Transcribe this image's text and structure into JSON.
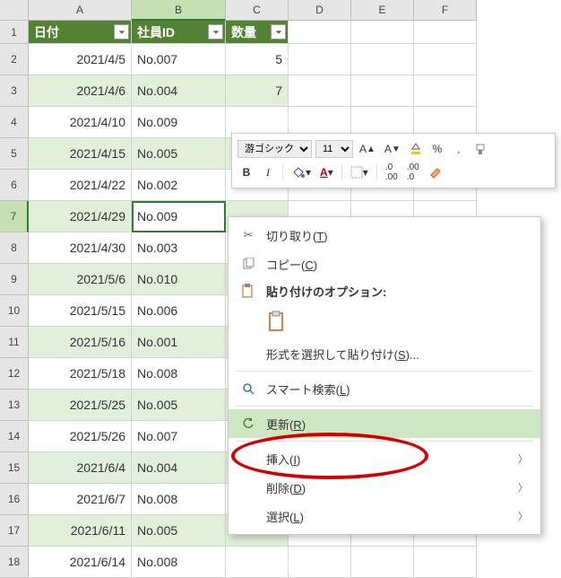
{
  "columns": [
    "A",
    "B",
    "C",
    "D",
    "E",
    "F"
  ],
  "headers": {
    "date": "日付",
    "empId": "社員ID",
    "qty": "数量"
  },
  "rows": [
    {
      "n": 1
    },
    {
      "n": 2,
      "date": "2021/4/5",
      "emp": "No.007",
      "qty": 5
    },
    {
      "n": 3,
      "date": "2021/4/6",
      "emp": "No.004",
      "qty": 7
    },
    {
      "n": 4,
      "date": "2021/4/10",
      "emp": "No.009",
      "qty": ""
    },
    {
      "n": 5,
      "date": "2021/4/15",
      "emp": "No.005",
      "qty": ""
    },
    {
      "n": 6,
      "date": "2021/4/22",
      "emp": "No.002",
      "qty": ""
    },
    {
      "n": 7,
      "date": "2021/4/29",
      "emp": "No.009",
      "qty": ""
    },
    {
      "n": 8,
      "date": "2021/4/30",
      "emp": "No.003",
      "qty": ""
    },
    {
      "n": 9,
      "date": "2021/5/6",
      "emp": "No.010",
      "qty": ""
    },
    {
      "n": 10,
      "date": "2021/5/15",
      "emp": "No.006",
      "qty": ""
    },
    {
      "n": 11,
      "date": "2021/5/16",
      "emp": "No.001",
      "qty": ""
    },
    {
      "n": 12,
      "date": "2021/5/18",
      "emp": "No.008",
      "qty": ""
    },
    {
      "n": 13,
      "date": "2021/5/25",
      "emp": "No.005",
      "qty": ""
    },
    {
      "n": 14,
      "date": "2021/5/26",
      "emp": "No.007",
      "qty": ""
    },
    {
      "n": 15,
      "date": "2021/6/4",
      "emp": "No.004",
      "qty": ""
    },
    {
      "n": 16,
      "date": "2021/6/7",
      "emp": "No.008",
      "qty": ""
    },
    {
      "n": 17,
      "date": "2021/6/11",
      "emp": "No.005",
      "qty": ""
    },
    {
      "n": 18,
      "date": "2021/6/14",
      "emp": "No.008",
      "qty": ""
    }
  ],
  "activeRow": 7,
  "toolbar": {
    "font": "游ゴシック",
    "size": "11",
    "bold": "B",
    "italic": "I",
    "percent": "%",
    "comma": ","
  },
  "contextMenu": {
    "cut": "切り取り(T)",
    "copy": "コピー(C)",
    "pasteOptionsLabel": "貼り付けのオプション:",
    "pasteSpecial": "形式を選択して貼り付け(S)...",
    "smartLookup": "スマート検索(L)",
    "refresh": "更新(R)",
    "insert": "挿入(I)",
    "delete": "削除(D)",
    "select": "選択(L)"
  }
}
